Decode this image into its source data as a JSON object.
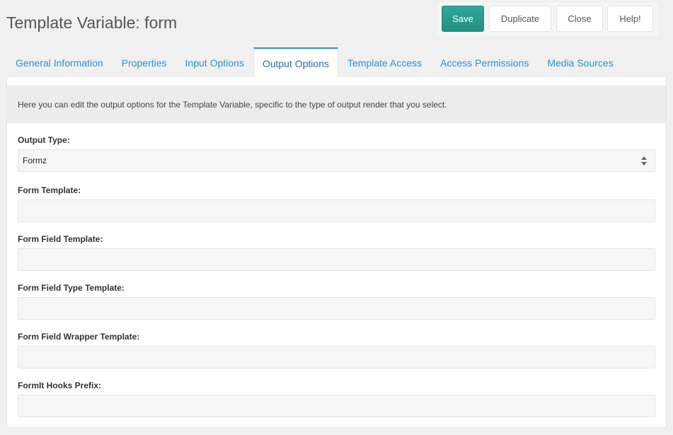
{
  "header": {
    "title": "Template Variable: form"
  },
  "actions": {
    "save": "Save",
    "duplicate": "Duplicate",
    "close": "Close",
    "help": "Help!"
  },
  "tabs": [
    {
      "label": "General Information"
    },
    {
      "label": "Properties"
    },
    {
      "label": "Input Options"
    },
    {
      "label": "Output Options"
    },
    {
      "label": "Template Access"
    },
    {
      "label": "Access Permissions"
    },
    {
      "label": "Media Sources"
    }
  ],
  "panel": {
    "description": "Here you can edit the output options for the Template Variable, specific to the type of output render that you select.",
    "fields": [
      {
        "label": "Output Type:",
        "value": "Formz"
      },
      {
        "label": "Form Template:",
        "value": ""
      },
      {
        "label": "Form Field Template:",
        "value": ""
      },
      {
        "label": "Form Field Type Template:",
        "value": ""
      },
      {
        "label": "Form Field Wrapper Template:",
        "value": ""
      },
      {
        "label": "FormIt Hooks Prefix:",
        "value": ""
      }
    ]
  },
  "colors": {
    "accent": "#2e91c9",
    "save": "#22917f"
  }
}
